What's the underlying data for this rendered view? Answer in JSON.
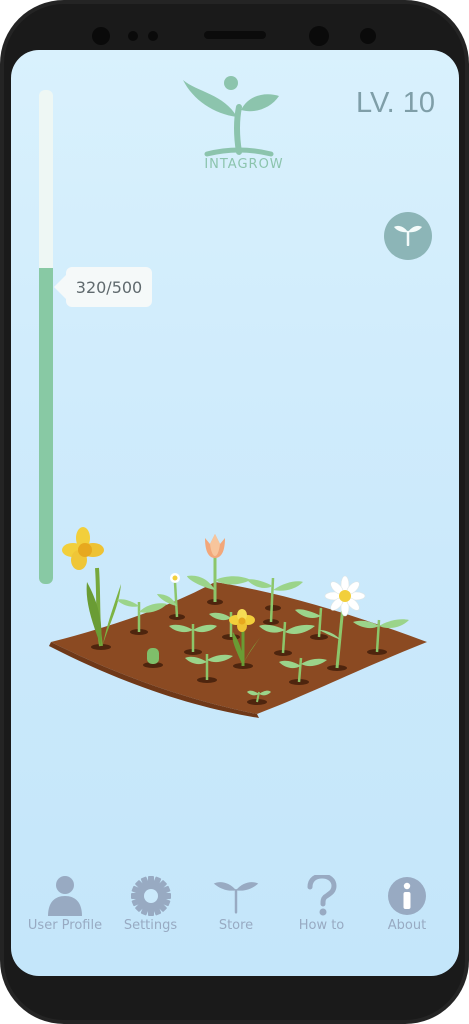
{
  "app": {
    "logo_text": "INTAGROW",
    "level": "LV. 10"
  },
  "xp": {
    "label": "320/500",
    "current": 320,
    "max": 500
  },
  "colors": {
    "accent": "#88c9a4",
    "nav_icon": "#98aac2",
    "soil": "#8b4a22",
    "leaf": "#9bd48a"
  },
  "nav": {
    "items": [
      {
        "label": "User Profile",
        "icon": "user-icon"
      },
      {
        "label": "Settings",
        "icon": "gear-icon"
      },
      {
        "label": "Store",
        "icon": "sprout-icon"
      },
      {
        "label": "How to",
        "icon": "question-icon"
      },
      {
        "label": "About",
        "icon": "info-icon"
      }
    ]
  }
}
